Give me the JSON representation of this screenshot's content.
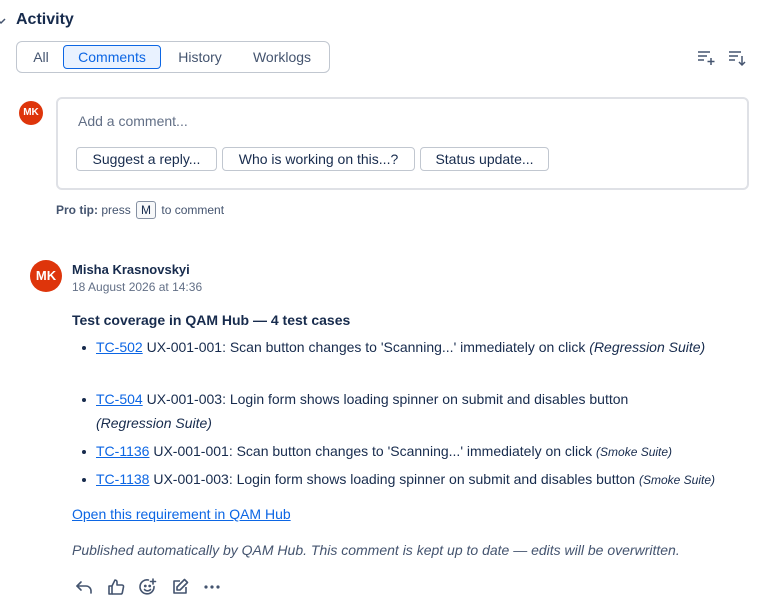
{
  "section": {
    "title": "Activity"
  },
  "tabs": [
    {
      "label": "All",
      "selected": false
    },
    {
      "label": "Comments",
      "selected": true
    },
    {
      "label": "History",
      "selected": false
    },
    {
      "label": "Worklogs",
      "selected": false
    }
  ],
  "toolbar_icons": [
    "sort-add-icon",
    "sort-descending-icon"
  ],
  "composer": {
    "avatar_initials": "MK",
    "placeholder": "Add a comment...",
    "suggestions": [
      "Suggest a reply...",
      "Who is working on this...?",
      "Status update..."
    ]
  },
  "pro_tip": {
    "label": "Pro tip:",
    "before": "press",
    "key": "M",
    "after": "to comment"
  },
  "comment": {
    "avatar_initials": "MK",
    "author": "Misha Krasnovskyi",
    "timestamp": "18 August 2026 at 14:36",
    "heading": "Test coverage in QAM Hub — 4 test cases",
    "items": [
      {
        "id": "TC-502",
        "text": "UX-001-001: Scan button changes to 'Scanning...' immediately on click",
        "suite": "(Regression Suite)"
      },
      {
        "id": "TC-504",
        "text": "UX-001-003: Login form shows loading spinner on submit and disables button",
        "suite": "(Regression Suite)"
      },
      {
        "id": "TC-1136",
        "text": "UX-001-001: Scan button changes to 'Scanning...' immediately on click",
        "suite": "(Smoke Suite)"
      },
      {
        "id": "TC-1138",
        "text": "UX-001-003: Login form shows loading spinner on submit and disables button",
        "suite": "(Smoke Suite)"
      }
    ],
    "requirement_link": "Open this requirement in QAM Hub",
    "footer_note": "Published automatically by QAM Hub. This comment is kept up to date — edits will be overwritten.",
    "actions": [
      "reply-icon",
      "like-icon",
      "add-reaction-icon",
      "edit-icon",
      "more-icon"
    ]
  },
  "colors": {
    "accent": "#0c66e4",
    "avatar_bg": "#de350b",
    "text": "#172b4d"
  }
}
